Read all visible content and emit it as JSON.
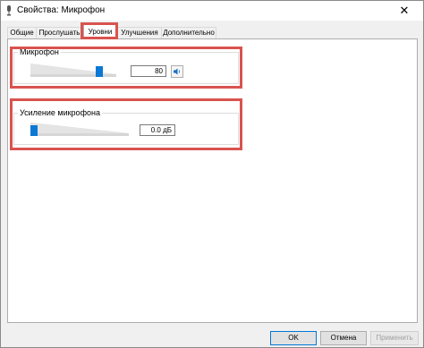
{
  "window": {
    "title": "Свойства: Микрофон",
    "close_symbol": "✕"
  },
  "tabs": [
    {
      "label": "Общие"
    },
    {
      "label": "Прослушать"
    },
    {
      "label": "Уровни"
    },
    {
      "label": "Улучшения"
    },
    {
      "label": "Дополнительно"
    }
  ],
  "active_tab": "Уровни",
  "microphone": {
    "label": "Микрофон",
    "value": "80",
    "level_fraction": 0.8,
    "speaker_icon": "speaker-icon"
  },
  "boost": {
    "label": "Усиление микрофона",
    "value": "0.0 дБ",
    "level_fraction": 0.0
  },
  "buttons": {
    "ok": "OK",
    "cancel": "Отмена",
    "apply": "Применить"
  },
  "colors": {
    "accent": "#0b78d4",
    "highlight": "#d9534f"
  }
}
